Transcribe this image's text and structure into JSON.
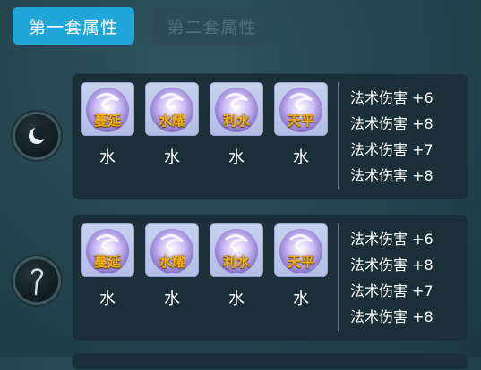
{
  "tabs": [
    {
      "label": "第一套属性",
      "active": true
    },
    {
      "label": "第二套属性",
      "active": false
    }
  ],
  "colors": {
    "active_tab": "#20a6d8",
    "inactive_tab": "#2d4c56",
    "gem_label": "#f0b21a",
    "panel": "#1a2f37",
    "background": "#24444d"
  },
  "panels": [
    {
      "icon": "crescent-moon-icon",
      "gems": [
        {
          "name": "蔓延",
          "element": "水"
        },
        {
          "name": "水耀",
          "element": "水"
        },
        {
          "name": "利水",
          "element": "水"
        },
        {
          "name": "天平",
          "element": "水"
        }
      ],
      "attributes": [
        "法术伤害 +6",
        "法术伤害 +8",
        "法术伤害 +7",
        "法术伤害 +8"
      ]
    },
    {
      "icon": "staff-hook-icon",
      "gems": [
        {
          "name": "蔓延",
          "element": "水"
        },
        {
          "name": "水耀",
          "element": "水"
        },
        {
          "name": "利水",
          "element": "水"
        },
        {
          "name": "天平",
          "element": "水"
        }
      ],
      "attributes": [
        "法术伤害 +6",
        "法术伤害 +8",
        "法术伤害 +7",
        "法术伤害 +8"
      ]
    }
  ]
}
